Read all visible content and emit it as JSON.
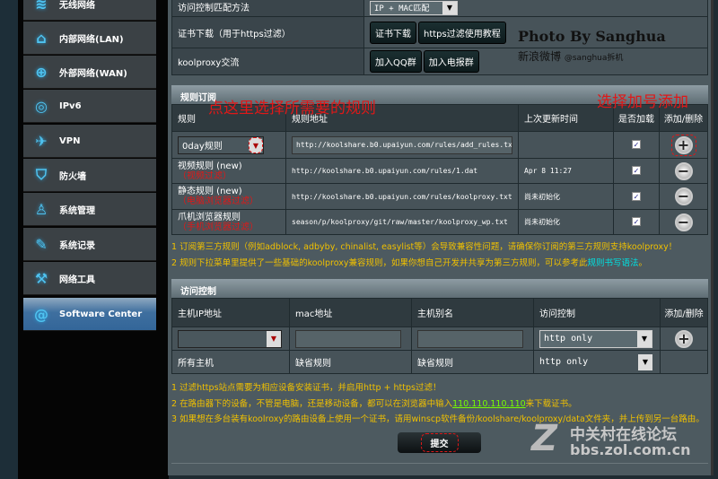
{
  "sidebar": {
    "items": [
      {
        "label": "无线网络",
        "icon": "wifi-icon"
      },
      {
        "label": "内部网络(LAN)",
        "icon": "home-icon"
      },
      {
        "label": "外部网络(WAN)",
        "icon": "globe-icon"
      },
      {
        "label": "IPv6",
        "icon": "ipv6-icon"
      },
      {
        "label": "VPN",
        "icon": "vpn-icon"
      },
      {
        "label": "防火墙",
        "icon": "shield-icon"
      },
      {
        "label": "系统管理",
        "icon": "user-icon"
      },
      {
        "label": "系统记录",
        "icon": "edit-icon"
      },
      {
        "label": "网络工具",
        "icon": "wrench-icon"
      },
      {
        "label": "Software Center",
        "icon": "swirl-icon"
      }
    ]
  },
  "settings": {
    "match_label": "访问控制匹配方法",
    "match_value": "IP + MAC匹配",
    "cert_label": "证书下载（用于https过滤）",
    "cert_btn": "证书下载",
    "tutorial_btn": "https过滤使用教程",
    "chat_label": "koolproxy交流",
    "qq_btn": "加入QQ群",
    "tg_btn": "加入电报群"
  },
  "watermark": {
    "photo": "Photo By Sanghua",
    "weibo": "新浪微博",
    "handle": "@sanghua拆机",
    "zol1": "中关村在线论坛",
    "zol2": "bbs.zol.com.cn"
  },
  "rules": {
    "title": "规则订阅",
    "headers": [
      "规则",
      "规则地址",
      "上次更新时间",
      "是否加载",
      "添加/删除"
    ],
    "new_rule": {
      "select": "0day规则",
      "url": "http://koolshare.b0.upaiyun.com/rules/add_rules.txt"
    },
    "rows": [
      {
        "name": "视频规则 (new)",
        "note": "（视频过滤）",
        "url": "http://koolshare.b0.upaiyun.com/rules/1.dat",
        "time": "Apr 8 11:27"
      },
      {
        "name": "静态规则 (new)",
        "note": "（电脑浏览器过滤）",
        "url": "http://koolshare.b0.upaiyun.com/rules/koolproxy.txt",
        "time": "尚未初始化"
      },
      {
        "name": "爪机浏览器规则",
        "note": "（手机浏览器过滤）",
        "url": "season/p/koolproxy/git/raw/master/koolproxy_wp.txt",
        "time": "尚未初始化"
      }
    ],
    "notes": [
      "1 订阅第三方规则（例如adblock, adbyby, chinalist, easylist等）会导致兼容性问题，请确保你订阅的第三方规则支持koolproxy！",
      "2 规则下拉菜单里提供了一些基础的koolproxy兼容规则，如果你想自己开发并共享为第三方规则，可以参考此"
    ],
    "link": "规则书写语法",
    "link_end": "。"
  },
  "annotations": {
    "select_hint": "点这里选择所需要的规则",
    "add_hint": "选择加号添加"
  },
  "access": {
    "title": "访问控制",
    "headers": [
      "主机IP地址",
      "mac地址",
      "主机别名",
      "访问控制",
      "添加/删除"
    ],
    "new_mode": "http only",
    "default": {
      "host": "所有主机",
      "mac": "缺省规则",
      "alias": "缺省规则",
      "mode": "http only"
    },
    "notes": [
      "1 过滤https站点需要为相应设备安装证书，并启用http + https过滤！",
      "2 在路由器下的设备，不管是电脑，还是移动设备，都可以在浏览器中输入",
      "来下载证书。",
      "3 如果想在多台装有koolroxy的路由设备上使用一个证书，请用winscp软件备份/koolshare/koolproxy/data文件夹，并上传到另一台路由。"
    ],
    "ip_link": "110.110.110.110"
  },
  "submit": "提交",
  "colors": {
    "panel": "#4d5a60",
    "note": "#f0c000",
    "annotation": "#e01818",
    "link": "#00e0e0"
  }
}
